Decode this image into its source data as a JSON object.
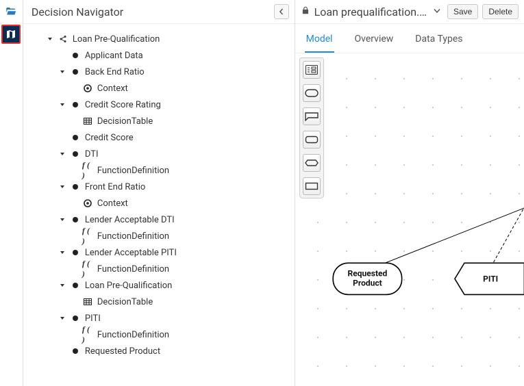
{
  "iconrail": {
    "folder_icon": "folder-open-icon",
    "map_icon": "map-icon"
  },
  "sidebar": {
    "title": "Decision Navigator",
    "collapse_label": "Collapse"
  },
  "tree": [
    {
      "depth": 0,
      "caret": "down",
      "icon": "share",
      "label": "Loan Pre-Qualification"
    },
    {
      "depth": 1,
      "caret": "",
      "icon": "dot",
      "label": "Applicant Data"
    },
    {
      "depth": 1,
      "caret": "down",
      "icon": "dot",
      "label": "Back End Ratio"
    },
    {
      "depth": 2,
      "caret": "",
      "icon": "target",
      "label": "Context"
    },
    {
      "depth": 1,
      "caret": "down",
      "icon": "dot",
      "label": "Credit Score Rating"
    },
    {
      "depth": 2,
      "caret": "",
      "icon": "table",
      "label": "DecisionTable"
    },
    {
      "depth": 1,
      "caret": "",
      "icon": "dot",
      "label": "Credit Score"
    },
    {
      "depth": 1,
      "caret": "down",
      "icon": "dot",
      "label": "DTI"
    },
    {
      "depth": 2,
      "caret": "",
      "icon": "fx",
      "label": "FunctionDefinition"
    },
    {
      "depth": 1,
      "caret": "down",
      "icon": "dot",
      "label": "Front End Ratio"
    },
    {
      "depth": 2,
      "caret": "",
      "icon": "target",
      "label": "Context"
    },
    {
      "depth": 1,
      "caret": "down",
      "icon": "dot",
      "label": "Lender Acceptable DTI"
    },
    {
      "depth": 2,
      "caret": "",
      "icon": "fx",
      "label": "FunctionDefinition"
    },
    {
      "depth": 1,
      "caret": "down",
      "icon": "dot",
      "label": "Lender Acceptable PITI"
    },
    {
      "depth": 2,
      "caret": "",
      "icon": "fx",
      "label": "FunctionDefinition"
    },
    {
      "depth": 1,
      "caret": "down",
      "icon": "dot",
      "label": "Loan Pre-Qualification"
    },
    {
      "depth": 2,
      "caret": "",
      "icon": "table",
      "label": "DecisionTable"
    },
    {
      "depth": 1,
      "caret": "down",
      "icon": "dot",
      "label": "PITI"
    },
    {
      "depth": 2,
      "caret": "",
      "icon": "fx",
      "label": "FunctionDefinition"
    },
    {
      "depth": 1,
      "caret": "",
      "icon": "dot",
      "label": "Requested Product"
    }
  ],
  "editor": {
    "file_title": "Loan prequalification.…",
    "save_label": "Save",
    "delete_label": "Delete"
  },
  "tabs": {
    "model": "Model",
    "overview": "Overview",
    "data_types": "Data Types"
  },
  "palette": {
    "tool1": "dmn-diagram-icon",
    "tool2": "oval-icon",
    "tool3": "annotation-icon",
    "tool4": "rounded-rect-icon",
    "tool5": "cut-rect-icon",
    "tool6": "rect-icon"
  },
  "canvas": {
    "node1_line1": "Requested",
    "node1_line2": "Product",
    "node2_label": "PITI"
  }
}
